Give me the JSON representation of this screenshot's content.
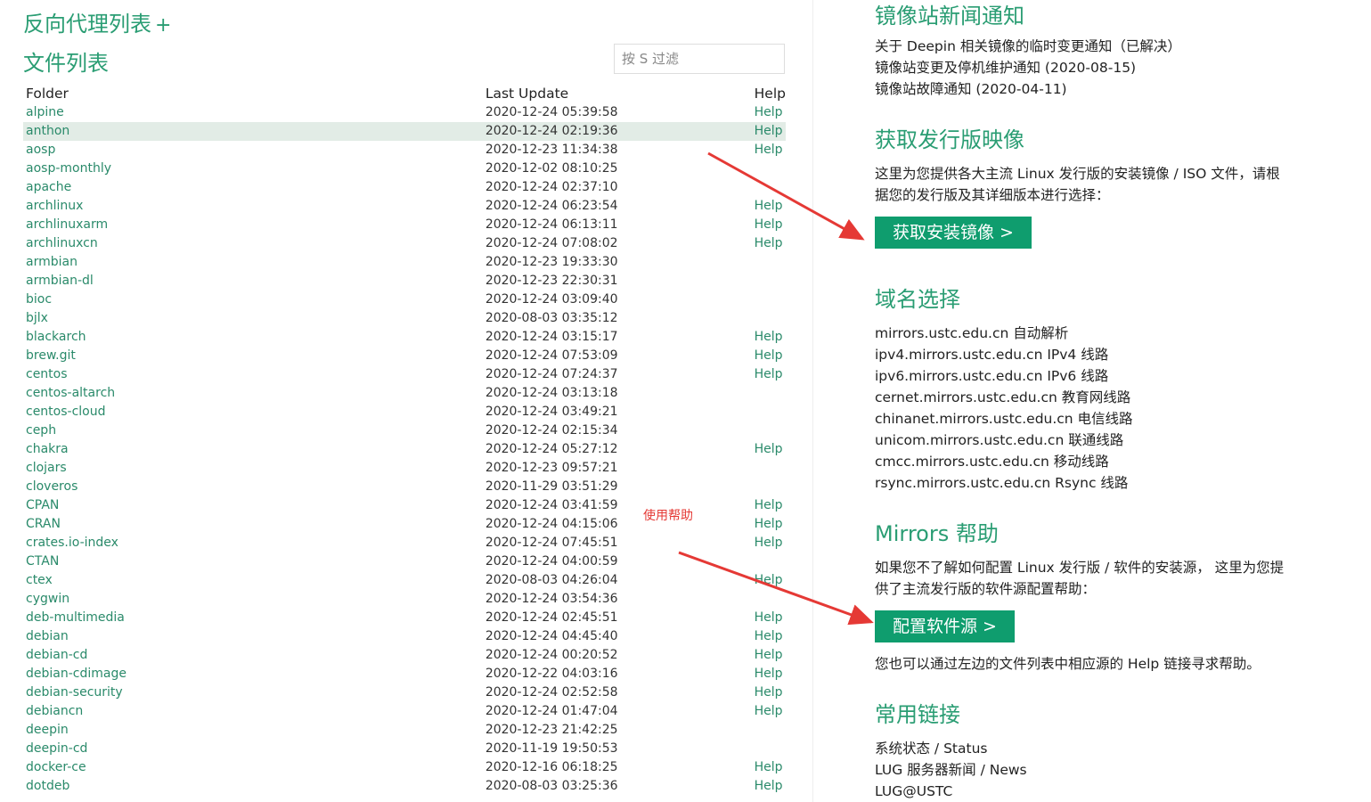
{
  "left": {
    "proxy_title": "反向代理列表",
    "proxy_toggle": "+",
    "files_title": "文件列表",
    "filter_placeholder": "按 S 过滤",
    "columns": {
      "folder": "Folder",
      "last_update": "Last Update",
      "help": "Help"
    },
    "rows": [
      {
        "name": "alpine",
        "date": "2020-12-24 05:39:58",
        "help": "Help"
      },
      {
        "name": "anthon",
        "date": "2020-12-24 02:19:36",
        "help": "Help",
        "highlight": true
      },
      {
        "name": "aosp",
        "date": "2020-12-23 11:34:38",
        "help": "Help"
      },
      {
        "name": "aosp-monthly",
        "date": "2020-12-02 08:10:25",
        "help": ""
      },
      {
        "name": "apache",
        "date": "2020-12-24 02:37:10",
        "help": ""
      },
      {
        "name": "archlinux",
        "date": "2020-12-24 06:23:54",
        "help": "Help"
      },
      {
        "name": "archlinuxarm",
        "date": "2020-12-24 06:13:11",
        "help": "Help"
      },
      {
        "name": "archlinuxcn",
        "date": "2020-12-24 07:08:02",
        "help": "Help"
      },
      {
        "name": "armbian",
        "date": "2020-12-23 19:33:30",
        "help": ""
      },
      {
        "name": "armbian-dl",
        "date": "2020-12-23 22:30:31",
        "help": ""
      },
      {
        "name": "bioc",
        "date": "2020-12-24 03:09:40",
        "help": ""
      },
      {
        "name": "bjlx",
        "date": "2020-08-03 03:35:12",
        "help": ""
      },
      {
        "name": "blackarch",
        "date": "2020-12-24 03:15:17",
        "help": "Help"
      },
      {
        "name": "brew.git",
        "date": "2020-12-24 07:53:09",
        "help": "Help"
      },
      {
        "name": "centos",
        "date": "2020-12-24 07:24:37",
        "help": "Help"
      },
      {
        "name": "centos-altarch",
        "date": "2020-12-24 03:13:18",
        "help": ""
      },
      {
        "name": "centos-cloud",
        "date": "2020-12-24 03:49:21",
        "help": ""
      },
      {
        "name": "ceph",
        "date": "2020-12-24 02:15:34",
        "help": ""
      },
      {
        "name": "chakra",
        "date": "2020-12-24 05:27:12",
        "help": "Help"
      },
      {
        "name": "clojars",
        "date": "2020-12-23 09:57:21",
        "help": ""
      },
      {
        "name": "cloveros",
        "date": "2020-11-29 03:51:29",
        "help": ""
      },
      {
        "name": "CPAN",
        "date": "2020-12-24 03:41:59",
        "help": "Help"
      },
      {
        "name": "CRAN",
        "date": "2020-12-24 04:15:06",
        "help": "Help"
      },
      {
        "name": "crates.io-index",
        "date": "2020-12-24 07:45:51",
        "help": "Help"
      },
      {
        "name": "CTAN",
        "date": "2020-12-24 04:00:59",
        "help": ""
      },
      {
        "name": "ctex",
        "date": "2020-08-03 04:26:04",
        "help": "Help"
      },
      {
        "name": "cygwin",
        "date": "2020-12-24 03:54:36",
        "help": ""
      },
      {
        "name": "deb-multimedia",
        "date": "2020-12-24 02:45:51",
        "help": "Help"
      },
      {
        "name": "debian",
        "date": "2020-12-24 04:45:40",
        "help": "Help"
      },
      {
        "name": "debian-cd",
        "date": "2020-12-24 00:20:52",
        "help": "Help"
      },
      {
        "name": "debian-cdimage",
        "date": "2020-12-22 04:03:16",
        "help": "Help"
      },
      {
        "name": "debian-security",
        "date": "2020-12-24 02:52:58",
        "help": "Help"
      },
      {
        "name": "debiancn",
        "date": "2020-12-24 01:47:04",
        "help": "Help"
      },
      {
        "name": "deepin",
        "date": "2020-12-23 21:42:25",
        "help": ""
      },
      {
        "name": "deepin-cd",
        "date": "2020-11-19 19:50:53",
        "help": ""
      },
      {
        "name": "docker-ce",
        "date": "2020-12-16 06:18:25",
        "help": "Help"
      },
      {
        "name": "dotdeb",
        "date": "2020-08-03 03:25:36",
        "help": "Help"
      }
    ]
  },
  "annotation": {
    "label": "使用帮助",
    "color": "#e53935"
  },
  "right": {
    "news": {
      "title": "镜像站新闻通知",
      "items": [
        "关于 Deepin 相关镜像的临时变更通知（已解决）",
        "镜像站变更及停机维护通知 (2020-08-15)",
        "镜像站故障通知 (2020-04-11)"
      ]
    },
    "iso": {
      "title": "获取发行版映像",
      "desc_line1": "这里为您提供各大主流 Linux 发行版的安装镜像 / ISO 文件，请根",
      "desc_line2": "据您的发行版及其详细版本进行选择：",
      "button": "获取安装镜像 >"
    },
    "domains": {
      "title": "域名选择",
      "items": [
        "mirrors.ustc.edu.cn 自动解析",
        "ipv4.mirrors.ustc.edu.cn IPv4 线路",
        "ipv6.mirrors.ustc.edu.cn IPv6 线路",
        "cernet.mirrors.ustc.edu.cn 教育网线路",
        "chinanet.mirrors.ustc.edu.cn 电信线路",
        "unicom.mirrors.ustc.edu.cn 联通线路",
        "cmcc.mirrors.ustc.edu.cn 移动线路",
        "rsync.mirrors.ustc.edu.cn Rsync 线路"
      ]
    },
    "help": {
      "title": "Mirrors 帮助",
      "desc_line1": "如果您不了解如何配置 Linux 发行版 / 软件的安装源， 这里为您提",
      "desc_line2": "供了主流发行版的软件源配置帮助：",
      "button": "配置软件源 >",
      "note": "您也可以通过左边的文件列表中相应源的 Help 链接寻求帮助。"
    },
    "links": {
      "title": "常用链接",
      "items": [
        "系统状态 / Status",
        "LUG 服务器新闻 / News",
        "LUG@USTC"
      ]
    }
  },
  "colors": {
    "accent": "#2a9d73",
    "button": "#0f9d6e",
    "highlight_row": "#e2ece6"
  }
}
